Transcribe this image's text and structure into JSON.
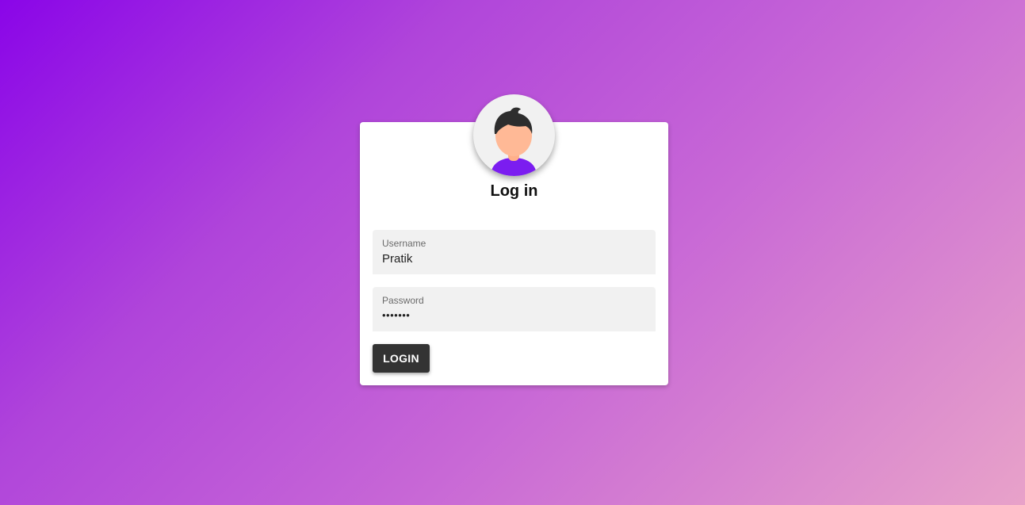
{
  "login": {
    "title": "Log in",
    "username": {
      "label": "Username",
      "value": "Pratik"
    },
    "password": {
      "label": "Password",
      "value": "•••••••"
    },
    "submit_label": "LOGIN"
  },
  "avatar": {
    "icon": "user-avatar-icon"
  }
}
